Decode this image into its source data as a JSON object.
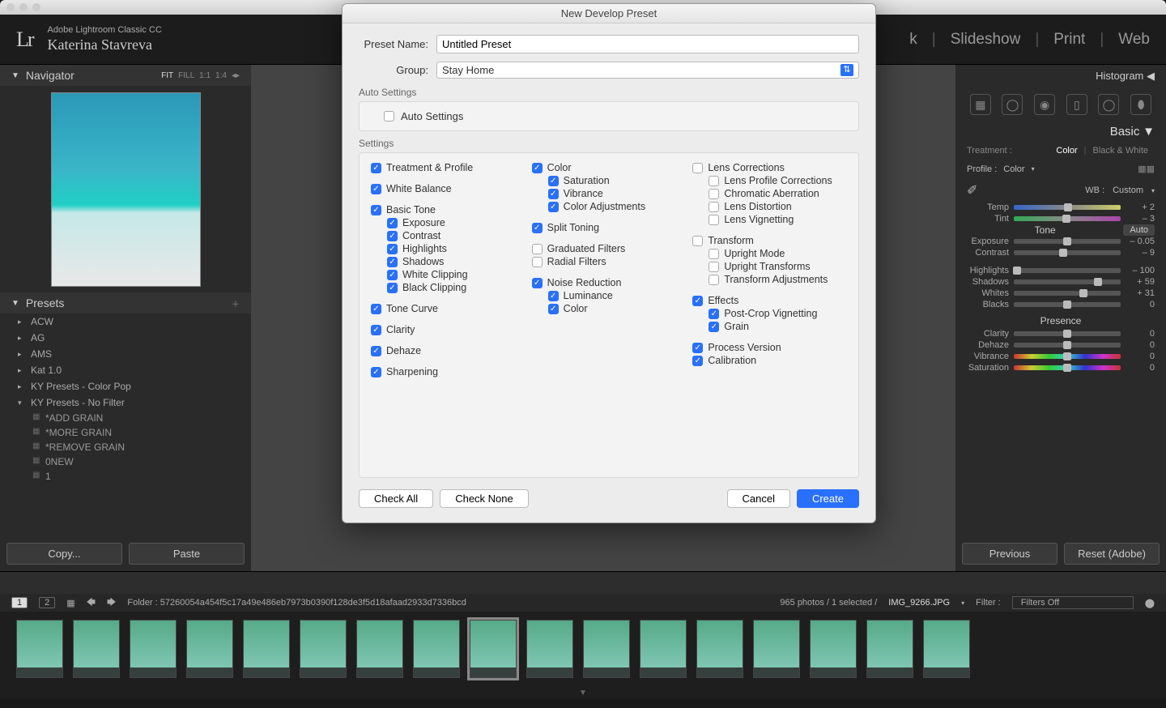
{
  "app": {
    "product": "Adobe Lightroom Classic CC",
    "user": "Katerina Stavreva",
    "logo": "Lr"
  },
  "modules": [
    "k",
    "Slideshow",
    "Print",
    "Web"
  ],
  "navigator": {
    "title": "Navigator",
    "zoom_options": [
      "FIT",
      "FILL",
      "1:1",
      "1:4"
    ],
    "active_zoom": "FIT"
  },
  "presets": {
    "title": "Presets",
    "groups": [
      "ACW",
      "AG",
      "AMS",
      "Kat 1.0",
      "KY Presets - Color Pop"
    ],
    "open_group": "KY Presets - No Filter",
    "subs": [
      "*ADD GRAIN",
      "*MORE GRAIN",
      "*REMOVE GRAIN",
      "0NEW",
      "1"
    ]
  },
  "left_buttons": {
    "copy": "Copy...",
    "paste": "Paste"
  },
  "right": {
    "histogram": "Histogram",
    "basic": "Basic",
    "treatment_label": "Treatment :",
    "treatment_color": "Color",
    "treatment_bw": "Black & White",
    "profile_label": "Profile :",
    "profile_value": "Color",
    "wb_label": "WB :",
    "wb_value": "Custom",
    "tone_label": "Tone",
    "auto": "Auto",
    "presence": "Presence",
    "sliders": {
      "temp": {
        "label": "Temp",
        "value": "+ 2",
        "pos": 51
      },
      "tint": {
        "label": "Tint",
        "value": "– 3",
        "pos": 49
      },
      "exposure": {
        "label": "Exposure",
        "value": "– 0.05",
        "pos": 50
      },
      "contrast": {
        "label": "Contrast",
        "value": "– 9",
        "pos": 46
      },
      "highlights": {
        "label": "Highlights",
        "value": "– 100",
        "pos": 3
      },
      "shadows": {
        "label": "Shadows",
        "value": "+ 59",
        "pos": 79
      },
      "whites": {
        "label": "Whites",
        "value": "+ 31",
        "pos": 65
      },
      "blacks": {
        "label": "Blacks",
        "value": "0",
        "pos": 50
      },
      "clarity": {
        "label": "Clarity",
        "value": "0",
        "pos": 50
      },
      "dehaze": {
        "label": "Dehaze",
        "value": "0",
        "pos": 50
      },
      "vibrance": {
        "label": "Vibrance",
        "value": "0",
        "pos": 50
      },
      "saturation": {
        "label": "Saturation",
        "value": "0",
        "pos": 50
      }
    },
    "previous": "Previous",
    "reset": "Reset (Adobe)"
  },
  "status": {
    "folder_label": "Folder :",
    "folder": "57260054a454f5c17a49e486eb7973b0390f128de3f5d18afaad2933d7336bcd",
    "count": "965 photos / 1 selected /",
    "filename": "IMG_9266.JPG",
    "filter_label": "Filter :",
    "filter_value": "Filters Off"
  },
  "dialog": {
    "title": "New Develop Preset",
    "preset_name_label": "Preset Name:",
    "preset_name_value": "Untitled Preset",
    "group_label": "Group:",
    "group_value": "Stay Home",
    "auto_section": "Auto Settings",
    "auto_checkbox": "Auto Settings",
    "settings_section": "Settings",
    "buttons": {
      "check_all": "Check All",
      "check_none": "Check None",
      "cancel": "Cancel",
      "create": "Create"
    },
    "col1": [
      {
        "label": "Treatment & Profile",
        "checked": true,
        "sub": false
      },
      {
        "spacer": true
      },
      {
        "label": "White Balance",
        "checked": true,
        "sub": false
      },
      {
        "spacer": true
      },
      {
        "label": "Basic Tone",
        "checked": true,
        "sub": false
      },
      {
        "label": "Exposure",
        "checked": true,
        "sub": true
      },
      {
        "label": "Contrast",
        "checked": true,
        "sub": true
      },
      {
        "label": "Highlights",
        "checked": true,
        "sub": true
      },
      {
        "label": "Shadows",
        "checked": true,
        "sub": true
      },
      {
        "label": "White Clipping",
        "checked": true,
        "sub": true
      },
      {
        "label": "Black Clipping",
        "checked": true,
        "sub": true
      },
      {
        "spacer": true
      },
      {
        "label": "Tone Curve",
        "checked": true,
        "sub": false
      },
      {
        "spacer": true
      },
      {
        "label": "Clarity",
        "checked": true,
        "sub": false
      },
      {
        "spacer": true
      },
      {
        "label": "Dehaze",
        "checked": true,
        "sub": false
      },
      {
        "spacer": true
      },
      {
        "label": "Sharpening",
        "checked": true,
        "sub": false
      }
    ],
    "col2": [
      {
        "label": "Color",
        "checked": true,
        "sub": false
      },
      {
        "label": "Saturation",
        "checked": true,
        "sub": true
      },
      {
        "label": "Vibrance",
        "checked": true,
        "sub": true
      },
      {
        "label": "Color Adjustments",
        "checked": true,
        "sub": true
      },
      {
        "spacer": true
      },
      {
        "label": "Split Toning",
        "checked": true,
        "sub": false
      },
      {
        "spacer": true
      },
      {
        "label": "Graduated Filters",
        "checked": false,
        "sub": false
      },
      {
        "label": "Radial Filters",
        "checked": false,
        "sub": false
      },
      {
        "spacer": true
      },
      {
        "label": "Noise Reduction",
        "checked": true,
        "sub": false
      },
      {
        "label": "Luminance",
        "checked": true,
        "sub": true
      },
      {
        "label": "Color",
        "checked": true,
        "sub": true
      }
    ],
    "col3": [
      {
        "label": "Lens Corrections",
        "checked": false,
        "sub": false
      },
      {
        "label": "Lens Profile Corrections",
        "checked": false,
        "sub": true
      },
      {
        "label": "Chromatic Aberration",
        "checked": false,
        "sub": true
      },
      {
        "label": "Lens Distortion",
        "checked": false,
        "sub": true
      },
      {
        "label": "Lens Vignetting",
        "checked": false,
        "sub": true
      },
      {
        "spacer": true
      },
      {
        "label": "Transform",
        "checked": false,
        "sub": false
      },
      {
        "label": "Upright Mode",
        "checked": false,
        "sub": true
      },
      {
        "label": "Upright Transforms",
        "checked": false,
        "sub": true
      },
      {
        "label": "Transform Adjustments",
        "checked": false,
        "sub": true
      },
      {
        "spacer": true
      },
      {
        "label": "Effects",
        "checked": true,
        "sub": false
      },
      {
        "label": "Post-Crop Vignetting",
        "checked": true,
        "sub": true
      },
      {
        "label": "Grain",
        "checked": true,
        "sub": true
      },
      {
        "spacer": true
      },
      {
        "label": "Process Version",
        "checked": true,
        "sub": false
      },
      {
        "label": "Calibration",
        "checked": true,
        "sub": false
      }
    ]
  }
}
